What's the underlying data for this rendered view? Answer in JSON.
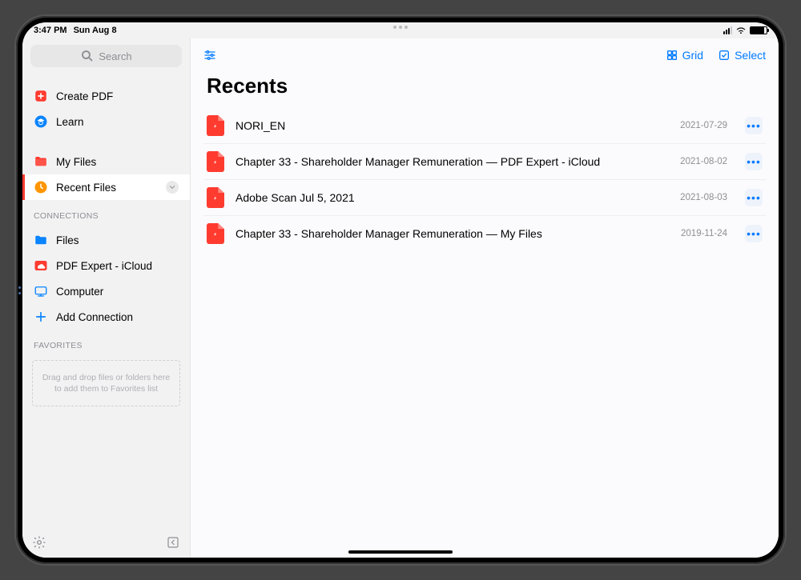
{
  "statusbar": {
    "time": "3:47 PM",
    "date": "Sun Aug 8"
  },
  "search": {
    "placeholder": "Search"
  },
  "sidebar": {
    "top": [
      {
        "label": "Create PDF"
      },
      {
        "label": "Learn"
      }
    ],
    "library": [
      {
        "label": "My Files"
      },
      {
        "label": "Recent Files"
      }
    ],
    "connections_header": "CONNECTIONS",
    "connections": [
      {
        "label": "Files"
      },
      {
        "label": "PDF Expert - iCloud"
      },
      {
        "label": "Computer"
      },
      {
        "label": "Add Connection"
      }
    ],
    "favorites_header": "FAVORITES",
    "favorites_hint": "Drag and drop files or folders here to add them to Favorites list"
  },
  "toolbar": {
    "grid": "Grid",
    "select": "Select"
  },
  "main": {
    "title": "Recents",
    "files": [
      {
        "name": "NORI_EN",
        "date": "2021-07-29"
      },
      {
        "name": "Chapter 33 - Shareholder Manager Remuneration — PDF Expert - iCloud",
        "date": "2021-08-02"
      },
      {
        "name": "Adobe Scan Jul 5, 2021",
        "date": "2021-08-03"
      },
      {
        "name": "Chapter 33 - Shareholder Manager Remuneration — My Files",
        "date": "2019-11-24"
      }
    ]
  }
}
